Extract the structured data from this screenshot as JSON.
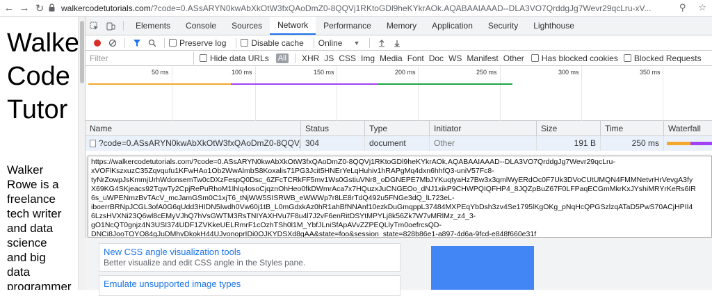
{
  "browser": {
    "url_host": "walkercodetutorials.com",
    "url_rest": "/?code=0.ASsARYN0kwAbXkOtW3fxQAoDmZ0-8QQVj1RKtoGDl9heKYkrAOk.AQABAAIAAAD--DLA3VO7QrddgJg7Wevr29qcLru-xV..."
  },
  "page": {
    "title_lines": [
      "Walker",
      "Code",
      "Tutor"
    ],
    "bio_lines": [
      "Walker",
      "Rowe is a",
      "freelance",
      "tech writer",
      "and data",
      "science",
      "and big",
      "data",
      "programmer"
    ]
  },
  "devtools": {
    "tabs": [
      "Elements",
      "Console",
      "Sources",
      "Network",
      "Performance",
      "Memory",
      "Application",
      "Security",
      "Lighthouse"
    ],
    "active_tab": "Network",
    "toolbar": {
      "preserve_log": "Preserve log",
      "disable_cache": "Disable cache",
      "throttle": "Online"
    },
    "filter": {
      "placeholder": "Filter",
      "hide_data_urls": "Hide data URLs",
      "all": "All",
      "types": [
        "XHR",
        "JS",
        "CSS",
        "Img",
        "Media",
        "Font",
        "Doc",
        "WS",
        "Manifest",
        "Other"
      ],
      "has_blocked_cookies": "Has blocked cookies",
      "blocked_requests": "Blocked Requests"
    },
    "overview": {
      "ticks": [
        "50 ms",
        "100 ms",
        "150 ms",
        "200 ms",
        "250 ms",
        "300 ms",
        "350 ms"
      ]
    },
    "table": {
      "headers": [
        "Name",
        "Status",
        "Type",
        "Initiator",
        "Size",
        "Time",
        "Waterfall"
      ],
      "rows": [
        {
          "name": "?code=0.ASsARYN0kwAbXkOtW3fxQAoDmZ0-8QQVj1...",
          "status": "304",
          "type": "document",
          "initiator": "Other",
          "size": "191 B",
          "time": "250 ms"
        }
      ]
    },
    "tooltip_lines": [
      "https://walkercodetutorials.com/?code=0.ASsARYN0kwAbXkOtW3fxQAoDmZ0-8QQVj1RKtoGDl9heKYkrAOk.AQABAAIAAAD--DLA3VO7QrddgJg7Wevr29qcLru-",
      "xVOFlKszxuzC35Zqvqufu1KFwHAo1Ob2WwAlmbS8Koxalis71PG3Jcit5HNErYeLqHuhiv1hRAPgMq4dxn6hhfQ3-uniV57Fc8-",
      "tyNrZowpJsKmmjUrhWdonsemTw0cDXzFespQ0Dsc_6ZFcTCRkFF5mv1Ws0GstiuVNr8_oDGNEPE7MbJYKuqtyaHz7Bw3x3qmlWyERdOc0F7Uk3DVoCUtUMQN4FMMNetvrHrVevgA3fy",
      "X69KG4SKjeacs92TqwTy2CpjRePuRhoM1Ihlq4osoCjqznOhHeo0fkDWmrAca7x7HQuzxJuCNGEOo_dNJ1xikP9CHWPQIQFHP4_8JQZpBuZ67F0LFPaqECGmMkrKxJYshiMRYrKeRs6IR",
      "6s_uWPENmzBvTAcV_mcJamGSm0C1xjT6_tNjWW5SISRWB_eWWWp7r8LE8rTdQ492u5FNGe3dQ_lL723eL-",
      "iboerrBRNpJCGL3ofA0G6qUdd3HIDN5Iwdh0Vw60j1tB_L0mGdxkAz0hR1ahBfNNAnf10ezkDuGmqppL37484MXPEqYbDsh3zv4Se1795lKgOKg_pNqHcQPGSzlzqATaD5PwS70ACjHPII4",
      "6LzsHVXNi23Q6wl8cEMyVJhQ7hVsGWTM3RsTNIYAXHVu7F8u4l7J2vF6enRitDSYtMPYLj8k56Zk7W7vMRlMz_z4_3-",
      "gO1NcQT0gnjz4N3USI374UDF1ZVKkeUELRmrF1cOzhTSh0l1M_YbfJLniSfApAVvZZPEQLlyTm0oefrcsQD-",
      "DNCi8JooTOYO84gJuDMhvDkokH44UJvonoprIDi0OJKYDSXd8gAA&state=foo&session_state=828b86e1-a897-4d6a-9fcd-e848f660e31f"
    ],
    "whats_new": [
      {
        "title": "New CSS angle visualization tools",
        "desc": "Better visualize and edit CSS angle in the Styles pane."
      },
      {
        "title": "Emulate unsupported image types",
        "desc": ""
      }
    ]
  }
}
